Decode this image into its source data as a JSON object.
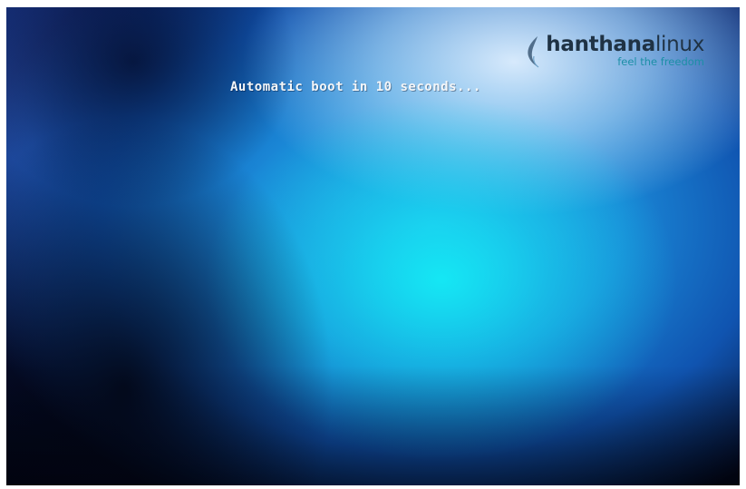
{
  "boot": {
    "message": "Automatic boot in 10 seconds..."
  },
  "logo": {
    "name_bold": "hanthana",
    "name_regular": "linux",
    "tagline": "feel the freedom",
    "icon": "hanthana-leaf-icon"
  },
  "colors": {
    "logo_text": "#1f3244",
    "tagline": "#1c8fa6",
    "boot_text": "#f4f6f8",
    "background_glow": "#14ebf5",
    "background_dark": "#02040e"
  }
}
